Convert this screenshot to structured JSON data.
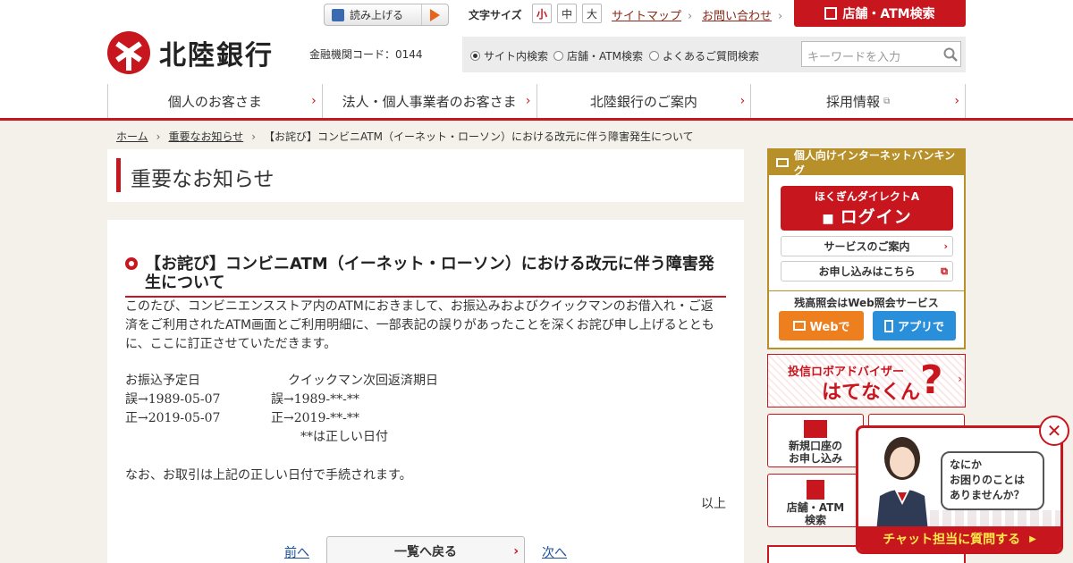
{
  "header": {
    "read_aloud": "読み上げる",
    "font_size_label": "文字サイズ",
    "font_sizes": [
      "小",
      "中",
      "大"
    ],
    "sitemap": "サイトマップ",
    "contact": "お問い合わせ",
    "atm_search": "店舗・ATM検索",
    "bank_name": "北陸銀行",
    "institution_code": "金融機関コード：0144",
    "search_options": [
      "サイト内検索",
      "店舗・ATM検索",
      "よくあるご質問検索"
    ],
    "search_placeholder": "キーワードを入力"
  },
  "nav": [
    "個人のお客さま",
    "法人・個人事業者のお客さま",
    "北陸銀行のご案内",
    "採用情報"
  ],
  "breadcrumb": {
    "home": "ホーム",
    "notices": "重要なお知らせ",
    "current": "【お詫び】コンビニATM（イーネット・ローソン）における改元に伴う障害発生について"
  },
  "page_title": "重要なお知らせ",
  "article": {
    "title": "【お詫び】コンビニATM（イーネット・ローソン）における改元に伴う障害発生について",
    "body": "このたび、コンビニエンスストア内のATMにおきまして、お振込みおよびクイックマンのお借入れ・ご返済をご利用されたATM画面とご利用明細に、一部表記の誤りがあったことを深くお詫び申し上げるとともに、ここに訂正させていただきます。",
    "col1_header": "お振込予定日",
    "col2_header": "クイックマン次回返済期日",
    "row_wrong_1": "誤→1989-05-07",
    "row_right_1": "正→2019-05-07",
    "row_wrong_2": "誤→1989-**-**",
    "row_right_2": "正→2019-**-**",
    "note": "**は正しい日付",
    "closing": "なお、お取引は上記の正しい日付で手続されます。",
    "end": "以上",
    "prev": "前へ",
    "list": "一覧へ戻る",
    "next": "次へ"
  },
  "sidebar": {
    "ibank_header": "個人向けインターネットバンキング",
    "login_line1": "ほくぎんダイレクトA",
    "login_line2": "ログイン",
    "services": "サービスのご案内",
    "apply": "お申し込みはこちら",
    "balance": "残高照会はWeb照会サービス",
    "web": "Webで",
    "app": "アプリで",
    "advisor_line1": "投信ロボアドバイザー",
    "advisor_line2": "はてなくん",
    "tile_new_account": "新規口座の\nお申し込み",
    "tile_atm": "店舗・ATM\n検索"
  },
  "chat": {
    "bubble": "なにか\nお困りのことは\nありませんか？",
    "bar": "チャット担当に質問する"
  },
  "colors": {
    "brand_red": "#c8161e",
    "gold": "#b8902a",
    "orange": "#ee7f1f",
    "blue": "#2a8fdb"
  }
}
